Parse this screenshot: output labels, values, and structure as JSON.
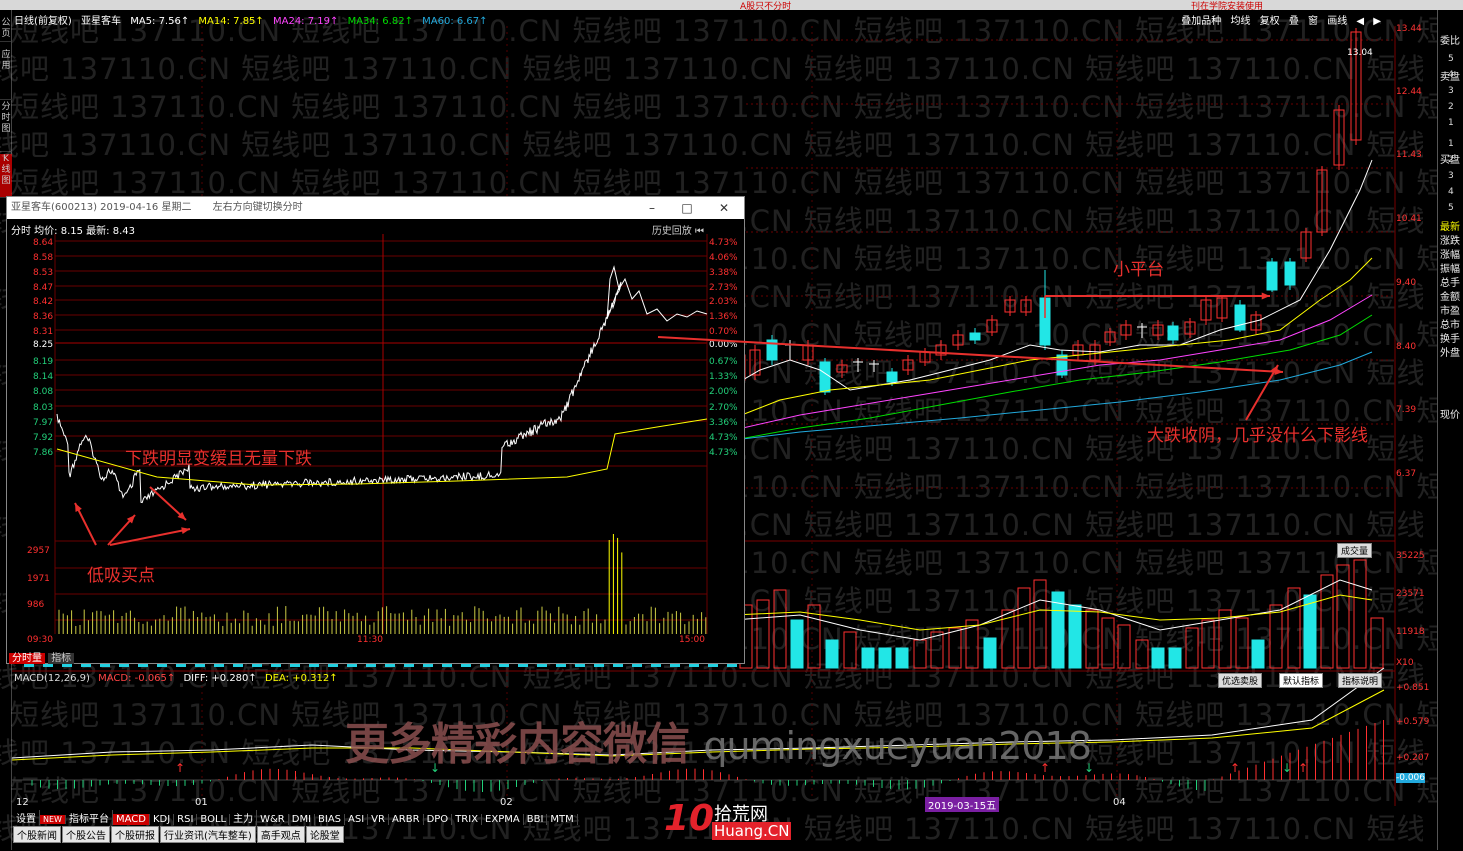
{
  "topbar": {
    "title": "A股只不分时",
    "right": "刊在学院安装使用"
  },
  "leftbar": [
    "公页",
    "应用",
    "分时图",
    "K线图"
  ],
  "stock": {
    "period": "日线(前复权)",
    "name": "亚星客车",
    "ma": [
      {
        "label": "MA5: 7.56↑",
        "color": "#ffffff"
      },
      {
        "label": "MA14: 7.85↑",
        "color": "#ffff00"
      },
      {
        "label": "MA24: 7.19↑",
        "color": "#ff44ff"
      },
      {
        "label": "MA34: 6.82↑",
        "color": "#00dd00"
      },
      {
        "label": "MA60: 6.67↑",
        "color": "#22aadd"
      }
    ]
  },
  "toolbar": [
    "叠加品种",
    "均线",
    "复权",
    "叠",
    "窗",
    "画线",
    "◀",
    "▶"
  ],
  "price_axis": [
    "13.44",
    "12.44",
    "11.43",
    "10.41",
    "9.40",
    "8.40",
    "7.39",
    "6.37"
  ],
  "high_label": "13.04",
  "volume_axis": [
    "35225",
    "23571",
    "11918",
    "X10"
  ],
  "vol_button": "成交量",
  "macd_axis": [
    "+0.851",
    "+0.579",
    "+0.207",
    "-0.006"
  ],
  "macd_buttons": [
    "优选卖股",
    "默认指标",
    "指标说明"
  ],
  "rightpanel": [
    "委比",
    "卖盘",
    "买盘",
    "最新",
    "涨跌",
    "涨幅",
    "振幅",
    "总手",
    "金额",
    "市盈",
    "总市",
    "换手",
    "外盘",
    "现价"
  ],
  "right_values": [
    "5",
    "4",
    "3",
    "2",
    "1",
    "1",
    "2",
    "3",
    "4",
    "5"
  ],
  "popup": {
    "title": "亚星客车(600213)  2019-04-16  星期二",
    "hint": "左右方向键切换分时",
    "info": "分时 均价: 8.15  最新: 8.43",
    "history": "历史回放",
    "left_prices": [
      "8.64",
      "8.58",
      "8.53",
      "8.47",
      "8.42",
      "8.36",
      "8.31",
      "8.25",
      "8.19",
      "8.14",
      "8.08",
      "8.03",
      "7.97",
      "7.92",
      "7.86"
    ],
    "right_pct": [
      "4.73%",
      "4.06%",
      "3.38%",
      "2.73%",
      "2.03%",
      "1.36%",
      "0.70%",
      "0.00%",
      "0.67%",
      "1.33%",
      "2.00%",
      "2.70%",
      "3.36%",
      "4.73%",
      "4.73%"
    ],
    "vol_labels": [
      "2957",
      "1971",
      "986"
    ],
    "time_labels": [
      "09:30",
      "11:30",
      "15:00"
    ],
    "tabs": [
      "分时量",
      "指标"
    ]
  },
  "macd": {
    "name": "MACD(12,26,9)",
    "values": [
      {
        "label": "MACD: -0.065↑",
        "color": "#ff4444"
      },
      {
        "label": "DIFF: +0.280↑",
        "color": "#ffffff"
      },
      {
        "label": "DEA: +0.312↑",
        "color": "#ffff00"
      }
    ]
  },
  "x_labels": [
    {
      "text": "12",
      "x": "12"
    },
    {
      "text": "01",
      "x": "01"
    },
    {
      "text": "02",
      "x": "02"
    },
    {
      "text": "04",
      "x": "04"
    }
  ],
  "date_badge": "2019-03-15五",
  "bottom_tabs": [
    "设置",
    "NEW",
    "指标平台",
    "MACD",
    "KDJ",
    "RSI",
    "BOLL",
    "主力",
    "W&R",
    "DMI",
    "BIAS",
    "ASI",
    "VR",
    "ARBR",
    "DPO",
    "TRIX",
    "EXPMA",
    "BBI",
    "MTM"
  ],
  "bottom_tabs2": [
    "个股新闻",
    "个股公告",
    "个股研报",
    "行业资讯(汽车整车)",
    "高手观点",
    "论股堂"
  ],
  "watermark": "短线吧 137110.CN 短线吧 137110.CN 短线吧 137110.CN 短线吧 137110.CN 短线吧 137110.CN 短线吧 137110.CN 短线吧 137110.CN 短线吧 137110.CN",
  "wechat": {
    "cn": "更多精彩内容微信",
    "id": "qumingxueyuan2018"
  },
  "logo": {
    "cn": "拾荒网",
    "en": "Huang.CN",
    "num": "10"
  },
  "annotations": {
    "platform": "小平台",
    "close": "大跌收阴，几乎没什么下影线",
    "slowdown": "下跌明显变缓且无量下跌",
    "lowbuy": "低吸买点"
  }
}
